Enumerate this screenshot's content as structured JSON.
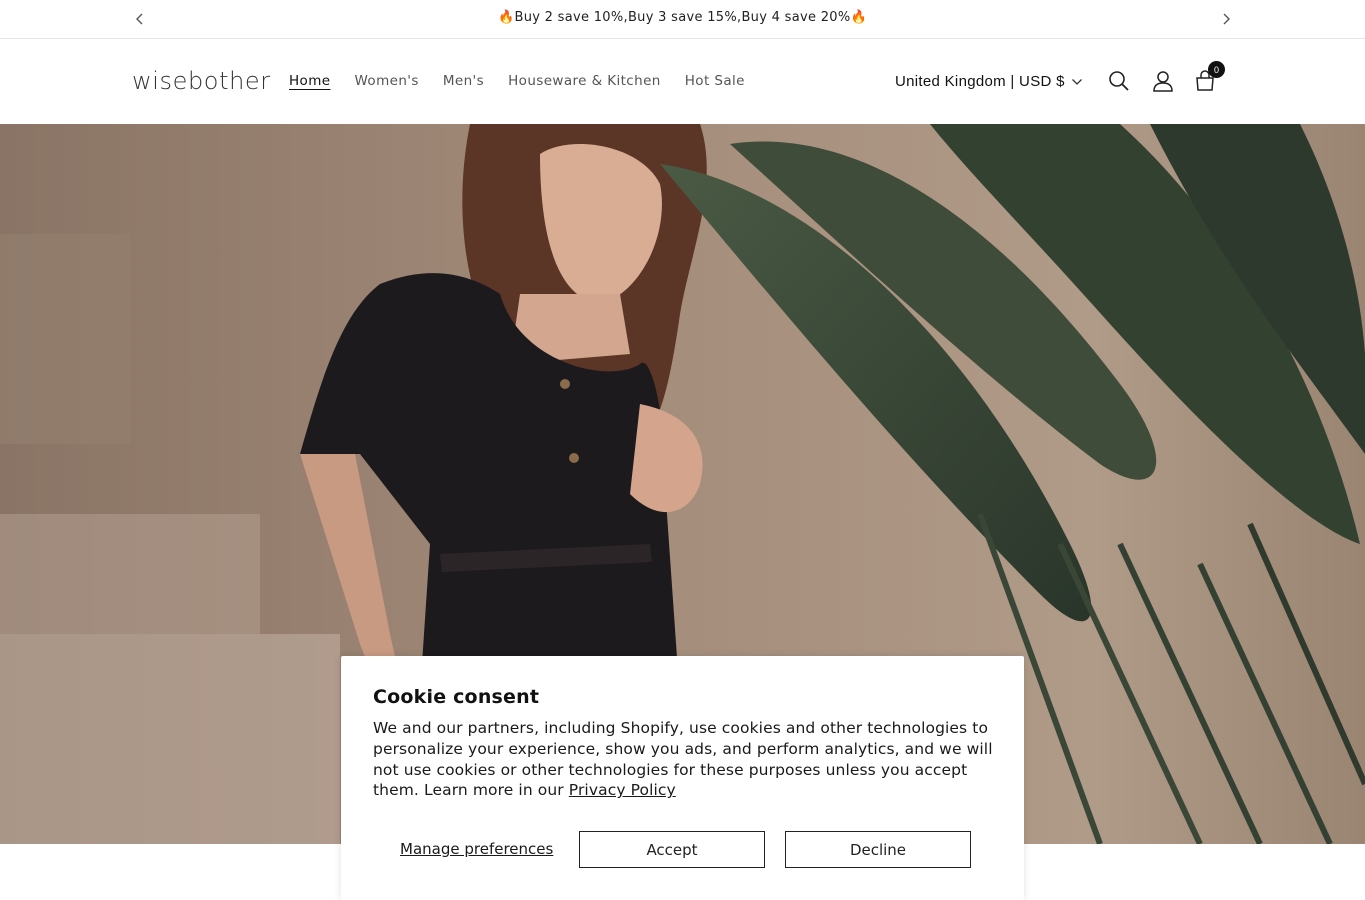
{
  "announcement": {
    "message": "🔥Buy 2 save 10%,Buy 3 save 15%,Buy 4 save 20%🔥",
    "prev_icon": "chevron-left-icon",
    "next_icon": "chevron-right-icon"
  },
  "header": {
    "logo": "wisebother",
    "nav": [
      {
        "label": "Home",
        "active": true
      },
      {
        "label": "Women's",
        "active": false
      },
      {
        "label": "Men's",
        "active": false
      },
      {
        "label": "Houseware & Kitchen",
        "active": false
      },
      {
        "label": "Hot Sale",
        "active": false
      }
    ],
    "locale": "United Kingdom | USD $",
    "cart_count": "0",
    "icons": [
      "search-icon",
      "account-icon",
      "cart-icon"
    ]
  },
  "hero": {
    "image": "woman in black knit dress beside large green leaves"
  },
  "cookie": {
    "title": "Cookie consent",
    "body": "We and our partners, including Shopify, use cookies and other technologies to personalize your experience, show you ads, and perform analytics, and we will not use cookies or other technologies for these purposes unless you accept them. Learn more in our ",
    "policy_link": "Privacy Policy",
    "manage_label": "Manage preferences",
    "accept_label": "Accept",
    "decline_label": "Decline"
  },
  "colors": {
    "text": "#121212",
    "border": "#e6e6e6",
    "hero_wall": "#a08a78",
    "leaf": "#3b4a36"
  }
}
